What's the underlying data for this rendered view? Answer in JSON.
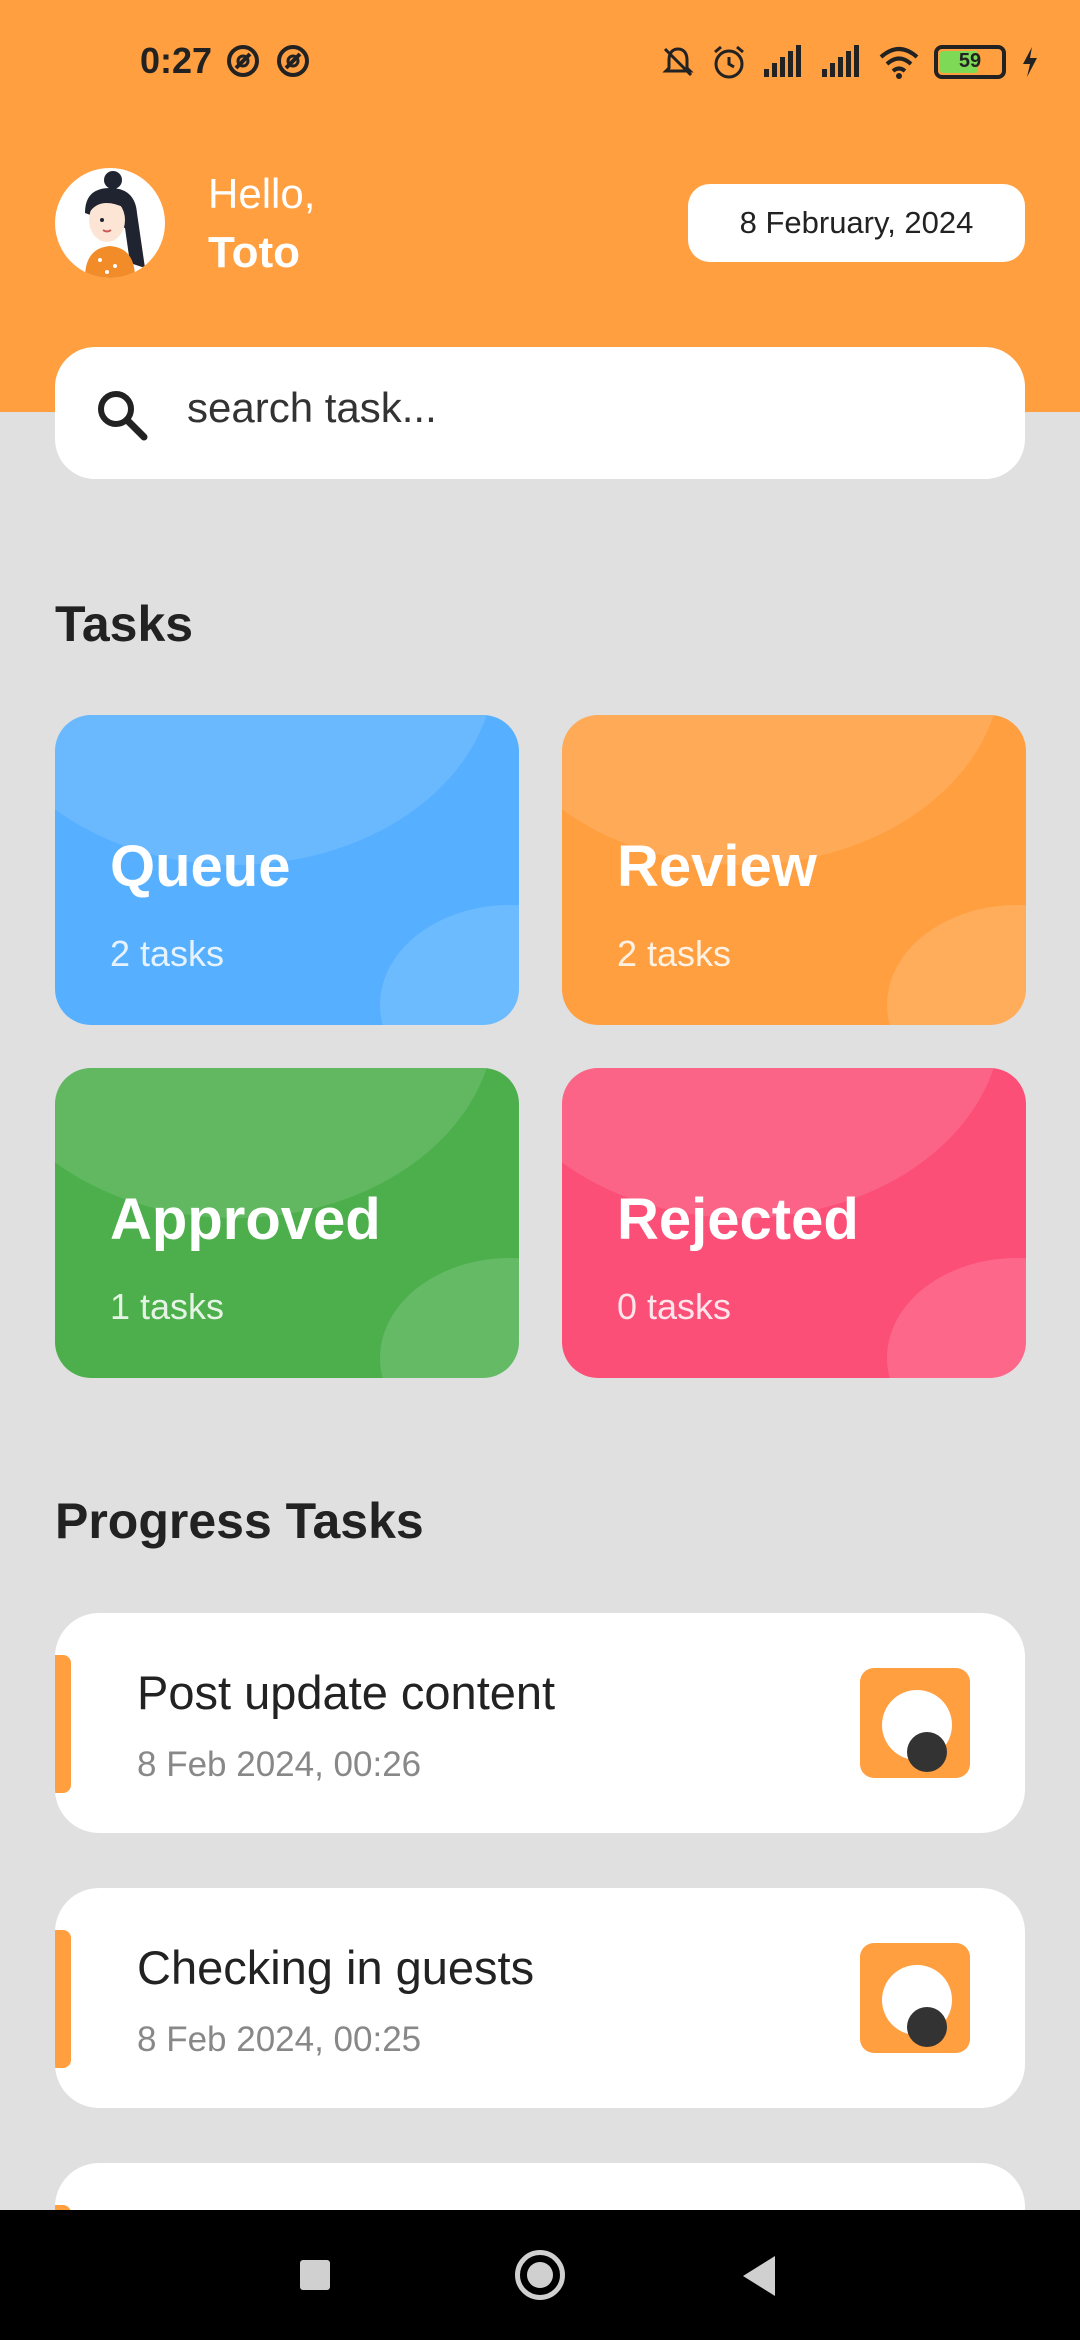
{
  "status_bar": {
    "time": "0:27",
    "battery_level": "59"
  },
  "header": {
    "greeting": "Hello,",
    "user_name": "Toto",
    "date": "8 February, 2024"
  },
  "search": {
    "placeholder": "search task..."
  },
  "tasks_section": {
    "title": "Tasks",
    "cards": [
      {
        "label": "Queue",
        "count": "2 tasks",
        "color": "#56b0ff"
      },
      {
        "label": "Review",
        "count": "2 tasks",
        "color": "#ff9f40"
      },
      {
        "label": "Approved",
        "count": "1 tasks",
        "color": "#4caf4c"
      },
      {
        "label": "Rejected",
        "count": "0 tasks",
        "color": "#fc4f77"
      }
    ]
  },
  "progress_section": {
    "title": "Progress Tasks",
    "items": [
      {
        "title": "Post update content",
        "time": "8 Feb 2024, 00:26"
      },
      {
        "title": "Checking in guests",
        "time": "8 Feb 2024, 00:25"
      }
    ]
  },
  "colors": {
    "accent": "#ff9f40",
    "background": "#e0e0e0"
  },
  "icons": {
    "search": "search-icon",
    "view": "eye-icon",
    "nav_recents": "square-icon",
    "nav_home": "circle-icon",
    "nav_back": "triangle-back-icon"
  }
}
